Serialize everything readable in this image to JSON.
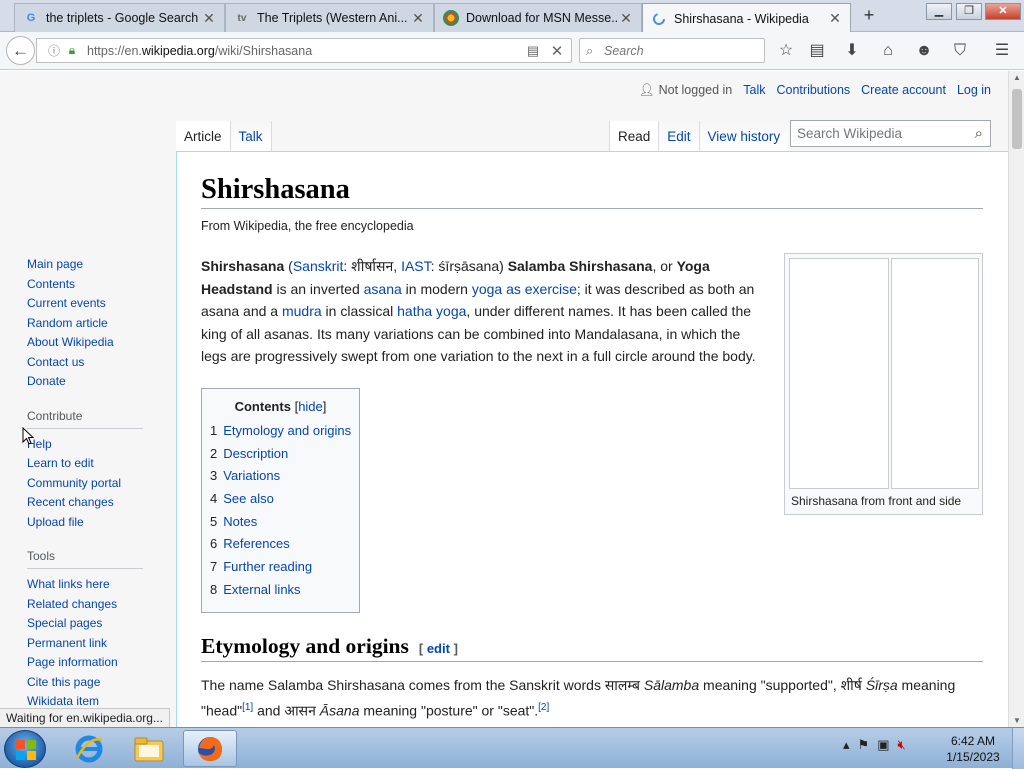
{
  "browser": {
    "tabs": [
      {
        "label": "the triplets - Google Search",
        "favicon": "G"
      },
      {
        "label": "The Triplets (Western Ani...",
        "favicon": "tv"
      },
      {
        "label": "Download for MSN Messe...",
        "favicon": "C"
      },
      {
        "label": "Shirshasana - Wikipedia",
        "favicon": "C"
      }
    ],
    "new_tab": "+",
    "url_prefix": "https://en.",
    "url_domain": "wikipedia.org",
    "url_path": "/wiki/Shirshasana",
    "search_placeholder": "Search",
    "status": "Waiting for en.wikipedia.org..."
  },
  "wiki": {
    "personal": {
      "not_logged_in": "Not logged in",
      "talk": "Talk",
      "contributions": "Contributions",
      "create_account": "Create account",
      "log_in": "Log in"
    },
    "tabs": {
      "article": "Article",
      "talk": "Talk",
      "read": "Read",
      "edit": "Edit",
      "view_history": "View history"
    },
    "search_placeholder": "Search Wikipedia",
    "sidebar": {
      "nav": [
        "Main page",
        "Contents",
        "Current events",
        "Random article",
        "About Wikipedia",
        "Contact us",
        "Donate"
      ],
      "contribute_heading": "Contribute",
      "contribute": [
        "Help",
        "Learn to edit",
        "Community portal",
        "Recent changes",
        "Upload file"
      ],
      "tools_heading": "Tools",
      "tools": [
        "What links here",
        "Related changes",
        "Special pages",
        "Permanent link",
        "Page information",
        "Cite this page",
        "Wikidata item"
      ]
    },
    "title": "Shirshasana",
    "tagline": "From Wikipedia, the free encyclopedia",
    "intro": {
      "term": "Shirshasana",
      "sanskrit_link": "Sanskrit",
      "sanskrit_text": ": शीर्षासन, ",
      "iast_link": "IAST",
      "iast_text": ": śīrṣāsana) ",
      "alt1": "Salamba Shirshasana",
      "or": ", or ",
      "alt2": "Yoga Headstand",
      "t1": " is an inverted ",
      "asana_link": "asana",
      "t2": " in modern ",
      "yoga_link": "yoga as exercise",
      "t3": "; it was described as both an asana and a ",
      "mudra_link": "mudra",
      "t4": " in classical ",
      "hatha_link": "hatha yoga",
      "t5": ", under different names. It has been called the king of all asanas. Its many variations can be combined into Mandalasana, in which the legs are progressively swept from one variation to the next in a full circle around the body."
    },
    "toc": {
      "title": "Contents",
      "hide": "hide",
      "items": [
        {
          "num": "1",
          "label": "Etymology and origins"
        },
        {
          "num": "2",
          "label": "Description"
        },
        {
          "num": "3",
          "label": "Variations"
        },
        {
          "num": "4",
          "label": "See also"
        },
        {
          "num": "5",
          "label": "Notes"
        },
        {
          "num": "6",
          "label": "References"
        },
        {
          "num": "7",
          "label": "Further reading"
        },
        {
          "num": "8",
          "label": "External links"
        }
      ]
    },
    "thumb_caption": "Shirshasana from front and side",
    "section": {
      "heading": "Etymology and origins",
      "edit": "edit",
      "s1": "The name Salamba Shirshasana comes from the Sanskrit words सालम्ब ",
      "salamba": "Sālamba",
      "s2": " meaning \"supported\", शीर्ष ",
      "sirsa": "Śīrṣa",
      "s3": " meaning \"head\"",
      "ref1": "[1]",
      "s4": " and आसन ",
      "asana": "Āsana",
      "s5": " meaning \"posture\" or \"seat\".",
      "ref2": "[2]"
    }
  },
  "taskbar": {
    "clock_time": "6:42 AM",
    "clock_date": "1/15/2023"
  }
}
